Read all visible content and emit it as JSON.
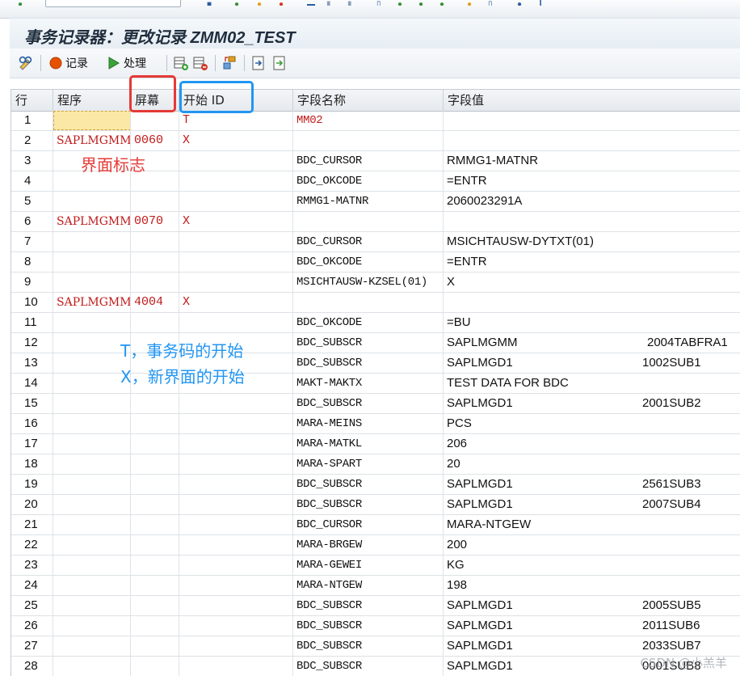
{
  "title": "事务记录器：更改记录 ZMM02_TEST",
  "toolbar": {
    "record_label": "记录",
    "process_label": "处理"
  },
  "columns": [
    "行",
    "程序",
    "屏幕",
    "开始 ID",
    "字段名称",
    "字段值"
  ],
  "rows": [
    {
      "line": "1",
      "program": "",
      "dynpro": "",
      "start": "T",
      "fnam": "MM02",
      "fval": "",
      "extra": ""
    },
    {
      "line": "2",
      "program": "SAPLMGMM",
      "dynpro": "0060",
      "start": "X",
      "fnam": "",
      "fval": "",
      "extra": ""
    },
    {
      "line": "3",
      "program": "",
      "dynpro": "",
      "start": "",
      "fnam": "BDC_CURSOR",
      "fval": "RMMG1-MATNR",
      "extra": ""
    },
    {
      "line": "4",
      "program": "",
      "dynpro": "",
      "start": "",
      "fnam": "BDC_OKCODE",
      "fval": "=ENTR",
      "extra": ""
    },
    {
      "line": "5",
      "program": "",
      "dynpro": "",
      "start": "",
      "fnam": "RMMG1-MATNR",
      "fval": "2060023291A",
      "extra": ""
    },
    {
      "line": "6",
      "program": "SAPLMGMM",
      "dynpro": "0070",
      "start": "X",
      "fnam": "",
      "fval": "",
      "extra": ""
    },
    {
      "line": "7",
      "program": "",
      "dynpro": "",
      "start": "",
      "fnam": "BDC_CURSOR",
      "fval": "MSICHTAUSW-DYTXT(01)",
      "extra": ""
    },
    {
      "line": "8",
      "program": "",
      "dynpro": "",
      "start": "",
      "fnam": "BDC_OKCODE",
      "fval": "=ENTR",
      "extra": ""
    },
    {
      "line": "9",
      "program": "",
      "dynpro": "",
      "start": "",
      "fnam": "MSICHTAUSW-KZSEL(01)",
      "fval": "X",
      "extra": ""
    },
    {
      "line": "10",
      "program": "SAPLMGMM",
      "dynpro": "4004",
      "start": "X",
      "fnam": "",
      "fval": "",
      "extra": ""
    },
    {
      "line": "11",
      "program": "",
      "dynpro": "",
      "start": "",
      "fnam": "BDC_OKCODE",
      "fval": "=BU",
      "extra": ""
    },
    {
      "line": "12",
      "program": "",
      "dynpro": "",
      "start": "",
      "fnam": "BDC_SUBSCR",
      "fval": "SAPLMGMM",
      "extra": "2004TABFRA1"
    },
    {
      "line": "13",
      "program": "",
      "dynpro": "",
      "start": "",
      "fnam": "BDC_SUBSCR",
      "fval": "SAPLMGD1",
      "extra": "1002SUB1"
    },
    {
      "line": "14",
      "program": "",
      "dynpro": "",
      "start": "",
      "fnam": "MAKT-MAKTX",
      "fval": "TEST DATA FOR BDC",
      "extra": ""
    },
    {
      "line": "15",
      "program": "",
      "dynpro": "",
      "start": "",
      "fnam": "BDC_SUBSCR",
      "fval": "SAPLMGD1",
      "extra": "2001SUB2"
    },
    {
      "line": "16",
      "program": "",
      "dynpro": "",
      "start": "",
      "fnam": "MARA-MEINS",
      "fval": "PCS",
      "extra": ""
    },
    {
      "line": "17",
      "program": "",
      "dynpro": "",
      "start": "",
      "fnam": "MARA-MATKL",
      "fval": "206",
      "extra": ""
    },
    {
      "line": "18",
      "program": "",
      "dynpro": "",
      "start": "",
      "fnam": "MARA-SPART",
      "fval": "20",
      "extra": ""
    },
    {
      "line": "19",
      "program": "",
      "dynpro": "",
      "start": "",
      "fnam": "BDC_SUBSCR",
      "fval": "SAPLMGD1",
      "extra": "2561SUB3"
    },
    {
      "line": "20",
      "program": "",
      "dynpro": "",
      "start": "",
      "fnam": "BDC_SUBSCR",
      "fval": "SAPLMGD1",
      "extra": "2007SUB4"
    },
    {
      "line": "21",
      "program": "",
      "dynpro": "",
      "start": "",
      "fnam": "BDC_CURSOR",
      "fval": "MARA-NTGEW",
      "extra": ""
    },
    {
      "line": "22",
      "program": "",
      "dynpro": "",
      "start": "",
      "fnam": "MARA-BRGEW",
      "fval": "200",
      "extra": ""
    },
    {
      "line": "23",
      "program": "",
      "dynpro": "",
      "start": "",
      "fnam": "MARA-GEWEI",
      "fval": "KG",
      "extra": ""
    },
    {
      "line": "24",
      "program": "",
      "dynpro": "",
      "start": "",
      "fnam": "MARA-NTGEW",
      "fval": "198",
      "extra": ""
    },
    {
      "line": "25",
      "program": "",
      "dynpro": "",
      "start": "",
      "fnam": "BDC_SUBSCR",
      "fval": "SAPLMGD1",
      "extra": "2005SUB5"
    },
    {
      "line": "26",
      "program": "",
      "dynpro": "",
      "start": "",
      "fnam": "BDC_SUBSCR",
      "fval": "SAPLMGD1",
      "extra": "2011SUB6"
    },
    {
      "line": "27",
      "program": "",
      "dynpro": "",
      "start": "",
      "fnam": "BDC_SUBSCR",
      "fval": "SAPLMGD1",
      "extra": "2033SUB7"
    },
    {
      "line": "28",
      "program": "",
      "dynpro": "",
      "start": "",
      "fnam": "BDC_SUBSCR",
      "fval": "SAPLMGD1",
      "extra": "0001SUB8"
    }
  ],
  "annotations": {
    "screen_flag": "界面标志",
    "tcode_start": "T，事务码的开始",
    "new_screen_start": "X，新界面的开始"
  },
  "watermark": "CSDN @小羔羊",
  "colors": {
    "program_text": "#c01a1a",
    "annotation_red": "#e53935",
    "annotation_blue": "#2196f3",
    "focus_cell": "#fbe8a6"
  },
  "icons": [
    "check-icon",
    "save-icon",
    "back-icon",
    "exit-icon",
    "cancel-icon",
    "print-icon",
    "find-icon",
    "first-page-icon",
    "prev-page-icon",
    "next-page-icon",
    "last-page-icon",
    "new-session-icon",
    "shortcut-icon",
    "help-icon",
    "layout-icon",
    "glasses-display-icon",
    "record-icon",
    "execute-icon",
    "insert-row-icon",
    "delete-row-icon",
    "sort-icon",
    "import-icon",
    "export-icon"
  ]
}
